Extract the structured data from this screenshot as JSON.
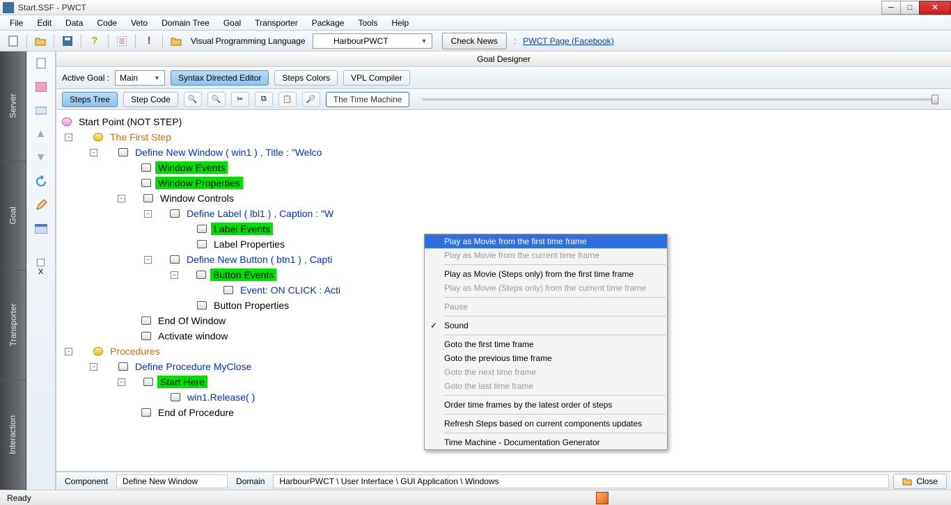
{
  "window": {
    "title": "Start.SSF - PWCT"
  },
  "menu": [
    "File",
    "Edit",
    "Data",
    "Code",
    "Veto",
    "Domain Tree",
    "Goal",
    "Transporter",
    "Package",
    "Tools",
    "Help"
  ],
  "toolbar": {
    "vpl_label": "Visual Programming Language",
    "vpl_value": "HarbourPWCT",
    "check_news": "Check News",
    "pwct_link": "PWCT Page (Facebook)"
  },
  "left_tabs": [
    "Server",
    "Goal",
    "Transporter",
    "Interaction"
  ],
  "goal": {
    "title": "Goal Designer",
    "active_goal_label": "Active Goal :",
    "active_goal_value": "Main",
    "buttons": {
      "syntax": "Syntax Directed Editor",
      "steps_colors": "Steps Colors",
      "vpl_compiler": "VPL Compiler",
      "steps_tree": "Steps Tree",
      "step_code": "Step Code",
      "time_machine": "The Time Machine"
    }
  },
  "tree": {
    "start_point": "Start Point (NOT STEP)",
    "first_step": "The First Step",
    "define_window": "Define New Window  ( win1 ) , Title : \"Welco",
    "window_events": "Window Events",
    "window_properties": "Window Properties",
    "window_controls": "Window Controls",
    "define_label": "Define Label ( lbl1 ) , Caption : \"W",
    "label_events": "Label Events",
    "label_properties": "Label Properties",
    "define_button": "Define New Button ( btn1 ) , Capti",
    "button_events": "Button Events",
    "event_onclick": "Event: ON CLICK : Acti",
    "button_properties": "Button Properties",
    "end_window": "End Of Window",
    "activate_window": "Activate window",
    "procedures": "Procedures",
    "define_procedure": "Define Procedure MyClose",
    "start_here": "Start Here",
    "win1_release": "win1.Release( )",
    "end_procedure": "End of Procedure"
  },
  "context_menu": {
    "play_first": "Play as Movie from the first time frame",
    "play_current": "Play as Movie from the current time frame",
    "play_steps_first": "Play as Movie (Steps only) from the first time frame",
    "play_steps_current": "Play as Movie (Steps only) from the current time frame",
    "pause": "Pause",
    "sound": "Sound",
    "goto_first": "Goto the first time frame",
    "goto_prev": "Goto the previous time frame",
    "goto_next": "Goto the next time frame",
    "goto_last": "Goto the last time frame",
    "order": "Order time frames by the latest order of steps",
    "refresh": "Refresh Steps based on current components updates",
    "docgen": "Time Machine - Documentation Generator"
  },
  "component_bar": {
    "component_label": "Component",
    "component_value": "Define New Window",
    "domain_label": "Domain",
    "domain_value": "HarbourPWCT  \\  User Interface  \\  GUI Application  \\  Windows",
    "close": "Close"
  },
  "status": {
    "ready": "Ready"
  },
  "icons": {
    "new": "new-file-icon",
    "open": "open-folder-icon",
    "save": "save-icon",
    "help": "help-icon",
    "list": "list-icon",
    "excl": "exclamation-icon",
    "folder": "folder-icon"
  }
}
